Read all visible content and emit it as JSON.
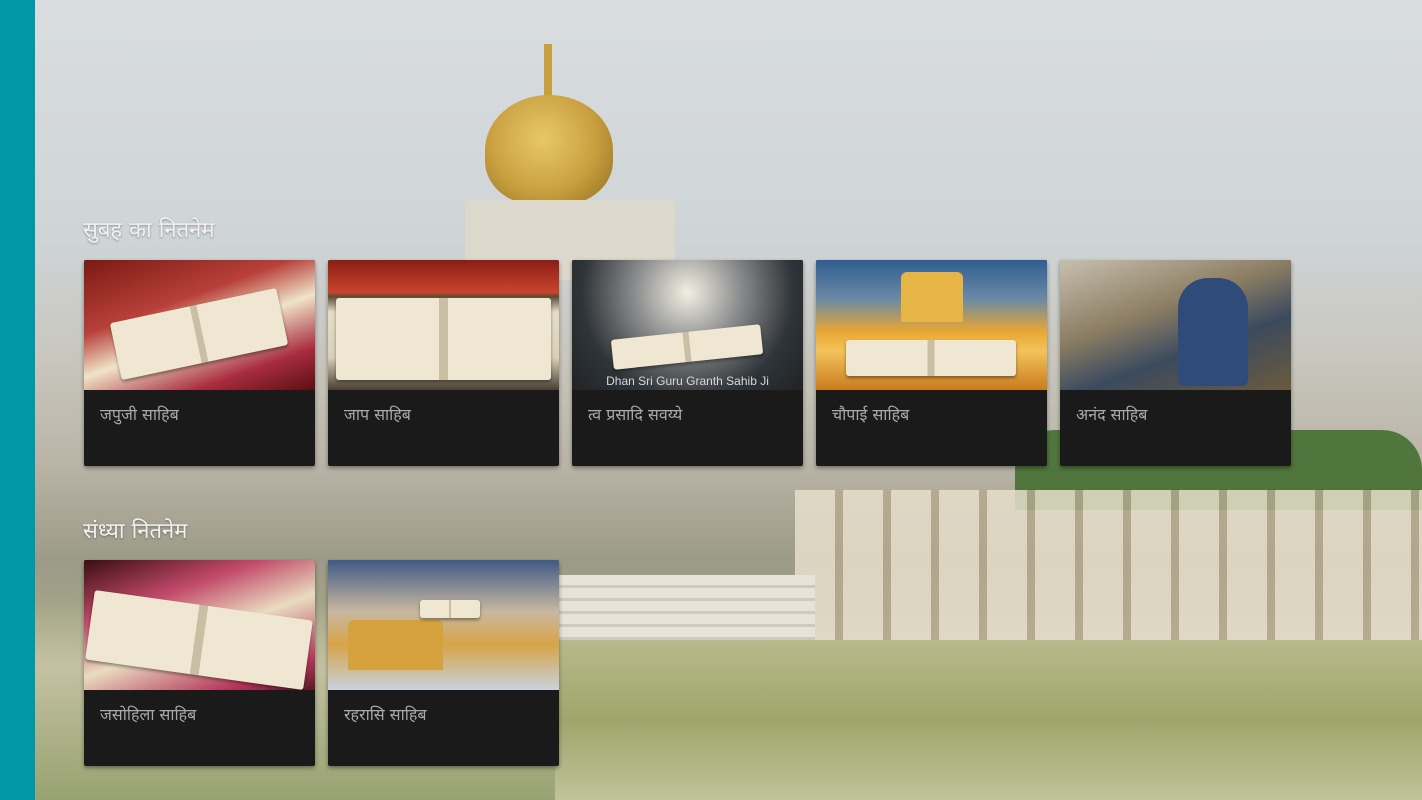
{
  "sections": [
    {
      "title": "सुबह का नितनेम",
      "cards": [
        {
          "label": "जपुजी साहिब",
          "thumb_icon": "gurbani-book-image"
        },
        {
          "label": "जाप साहिब",
          "thumb_icon": "open-scripture-image"
        },
        {
          "label": "त्व प्रसादि सवय्ये",
          "thumb_icon": "guru-granth-sahib-image",
          "caption": "Dhan Sri Guru Granth Sahib Ji"
        },
        {
          "label": "चौपाई साहिब",
          "thumb_icon": "golden-temple-book-image"
        },
        {
          "label": "अनंद साहिब",
          "thumb_icon": "praying-sikh-image"
        }
      ]
    },
    {
      "title": "संध्या नितनेम",
      "cards": [
        {
          "label": "जसोहिला साहिब",
          "thumb_icon": "scripture-closeup-image"
        },
        {
          "label": "रहरासि साहिब",
          "thumb_icon": "gurus-golden-temple-image"
        }
      ]
    }
  ],
  "colors": {
    "sidebar": "#0097a7",
    "card_bg": "#1a1a1a",
    "card_text": "#a9a9a9",
    "section_title": "#f1f1f1"
  }
}
